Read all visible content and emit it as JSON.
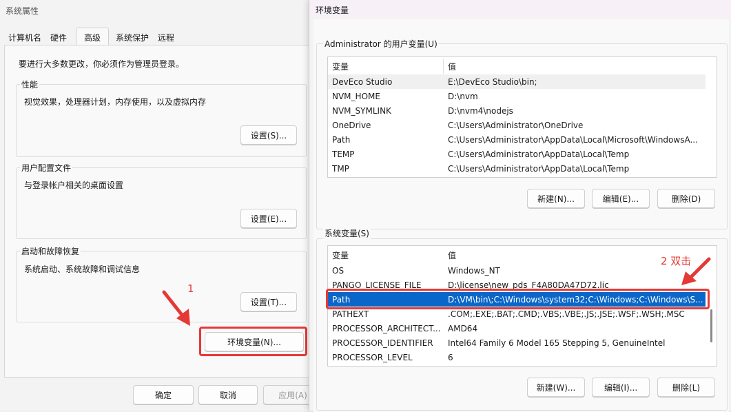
{
  "sys_props": {
    "title": "系统属性",
    "tabs": [
      "计算机名",
      "硬件",
      "高级",
      "系统保护",
      "远程"
    ],
    "admin_note": "要进行大多数更改，你必须作为管理员登录。",
    "perf": {
      "title": "性能",
      "desc": "视觉效果，处理器计划，内存使用，以及虚拟内存",
      "button": "设置(S)..."
    },
    "profile": {
      "title": "用户配置文件",
      "desc": "与登录帐户相关的桌面设置",
      "button": "设置(E)..."
    },
    "startup": {
      "title": "启动和故障恢复",
      "desc": "系统启动、系统故障和调试信息",
      "button": "设置(T)..."
    },
    "env_button": "环境变量(N)...",
    "ok": "确定",
    "cancel": "取消",
    "apply": "应用(A)"
  },
  "env_vars": {
    "title": "环境变量",
    "user_group": "Administrator 的用户变量(U)",
    "col_var": "变量",
    "col_val": "值",
    "user_rows": [
      {
        "name": "DevEco Studio",
        "value": "E:\\DevEco Studio\\bin;"
      },
      {
        "name": "NVM_HOME",
        "value": "D:\\nvm"
      },
      {
        "name": "NVM_SYMLINK",
        "value": "D:\\nvm4\\nodejs"
      },
      {
        "name": "OneDrive",
        "value": "C:\\Users\\Administrator\\OneDrive"
      },
      {
        "name": "Path",
        "value": "C:\\Users\\Administrator\\AppData\\Local\\Microsoft\\WindowsA..."
      },
      {
        "name": "TEMP",
        "value": "C:\\Users\\Administrator\\AppData\\Local\\Temp"
      },
      {
        "name": "TMP",
        "value": "C:\\Users\\Administrator\\AppData\\Local\\Temp"
      }
    ],
    "user_buttons": {
      "new": "新建(N)...",
      "edit": "编辑(E)...",
      "delete": "删除(D)"
    },
    "sys_group": "系统变量(S)",
    "sys_rows": [
      {
        "name": "OS",
        "value": "Windows_NT"
      },
      {
        "name": "PANGO_LICENSE_FILE",
        "value": "D:\\license\\new_pds_F4A80DA47D72.lic"
      },
      {
        "name": "Path",
        "value": "D:\\VM\\bin\\;C:\\Windows\\system32;C:\\Windows;C:\\Windows\\S..."
      },
      {
        "name": "PATHEXT",
        "value": ".COM;.EXE;.BAT;.CMD;.VBS;.VBE;.JS;.JSE;.WSF;.WSH;.MSC"
      },
      {
        "name": "PROCESSOR_ARCHITECT...",
        "value": "AMD64"
      },
      {
        "name": "PROCESSOR_IDENTIFIER",
        "value": "Intel64 Family 6 Model 165 Stepping 5, GenuineIntel"
      },
      {
        "name": "PROCESSOR_LEVEL",
        "value": "6"
      }
    ],
    "sys_buttons": {
      "new": "新建(W)...",
      "edit": "编辑(I)...",
      "delete": "删除(L)"
    }
  },
  "annotations": {
    "step1": "1",
    "step2": "2 双击",
    "color": "#e53935"
  },
  "colors": {
    "selection": "#0a66c8",
    "accent_red": "#e53935"
  }
}
